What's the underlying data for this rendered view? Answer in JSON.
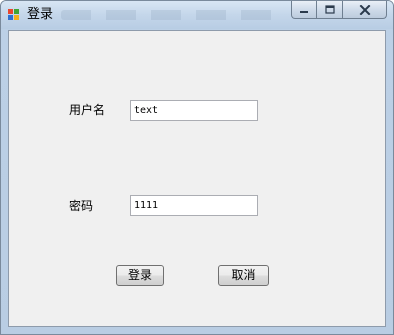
{
  "window": {
    "title": "登录",
    "icon": "windows-form-icon"
  },
  "controls": {
    "minimize": "minimize-icon",
    "maximize": "maximize-icon",
    "close": "close-icon"
  },
  "form": {
    "username_label": "用户名",
    "username_value": "text",
    "password_label": "密码",
    "password_value": "1111",
    "login_button": "登录",
    "cancel_button": "取消"
  }
}
